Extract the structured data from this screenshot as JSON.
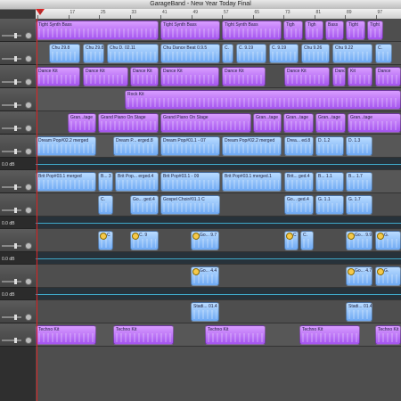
{
  "window": {
    "title": "GarageBand - New Year Today Final"
  },
  "ruler": {
    "ticks": [
      "9",
      "17",
      "25",
      "33",
      "41",
      "49",
      "57",
      "65",
      "73",
      "81",
      "89",
      "97"
    ]
  },
  "tracks": [
    {
      "type": "instrument",
      "regions": [
        {
          "name": "Tight Synth Bass",
          "color": "purple",
          "start": 0,
          "end": 138
        },
        {
          "name": "Tight Synth Bass",
          "color": "purple",
          "start": 140,
          "end": 207
        },
        {
          "name": "Tight Synth Bass",
          "color": "purple",
          "start": 209,
          "end": 276
        },
        {
          "name": "Tigh",
          "color": "purple",
          "start": 278,
          "end": 300
        },
        {
          "name": "Tigh",
          "color": "purple",
          "start": 302,
          "end": 323
        },
        {
          "name": "Bass",
          "color": "purple",
          "start": 325,
          "end": 346
        },
        {
          "name": "Tight",
          "color": "purple",
          "start": 348,
          "end": 370
        },
        {
          "name": "Tight",
          "color": "purple",
          "start": 372,
          "end": 390
        }
      ]
    },
    {
      "type": "instrument",
      "regions": [
        {
          "name": "Chu 29.8",
          "color": "blue",
          "start": 15,
          "end": 50
        },
        {
          "name": "Chu 29.8",
          "color": "blue",
          "start": 53,
          "end": 77
        },
        {
          "name": "Chu D. 02.11",
          "color": "blue",
          "start": 80,
          "end": 138
        },
        {
          "name": "Chu Dance Beat 0.9.5",
          "color": "blue",
          "start": 140,
          "end": 207
        },
        {
          "name": "C.",
          "color": "blue",
          "start": 209,
          "end": 222
        },
        {
          "name": "C. 9.19",
          "color": "blue",
          "start": 225,
          "end": 259
        },
        {
          "name": "C. 9.19",
          "color": "blue",
          "start": 262,
          "end": 295
        },
        {
          "name": "Chu 9.26",
          "color": "blue",
          "start": 298,
          "end": 330
        },
        {
          "name": "Chu 9.22",
          "color": "blue",
          "start": 333,
          "end": 378
        },
        {
          "name": "C.",
          "color": "blue",
          "start": 381,
          "end": 400
        }
      ]
    },
    {
      "type": "instrument",
      "regions": [
        {
          "name": "Dance Kit",
          "color": "purple",
          "start": 0,
          "end": 50
        },
        {
          "name": "Dance Kit",
          "color": "purple",
          "start": 53,
          "end": 104
        },
        {
          "name": "Dance Kit",
          "color": "purple",
          "start": 106,
          "end": 138
        },
        {
          "name": "Dance Kit",
          "color": "purple",
          "start": 140,
          "end": 206
        },
        {
          "name": "Dance Kit",
          "color": "purple",
          "start": 209,
          "end": 258
        },
        {
          "name": "Dance Kit",
          "color": "purple",
          "start": 279,
          "end": 330
        },
        {
          "name": "Dance",
          "color": "purple",
          "start": 333,
          "end": 348
        },
        {
          "name": "Kit",
          "color": "purple",
          "start": 350,
          "end": 378
        },
        {
          "name": "Dance",
          "color": "purple",
          "start": 381,
          "end": 410
        }
      ]
    },
    {
      "type": "instrument",
      "regions": [
        {
          "name": "Rock Kit",
          "color": "purple",
          "start": 100,
          "end": 410
        }
      ]
    },
    {
      "type": "instrument",
      "regions": [
        {
          "name": "Gran...tage",
          "color": "purple",
          "start": 36,
          "end": 68
        },
        {
          "name": "Grand Piano On Stage",
          "color": "purple",
          "start": 70,
          "end": 138
        },
        {
          "name": "Grand Piano On Stage",
          "color": "purple",
          "start": 140,
          "end": 242
        },
        {
          "name": "Gran...tage",
          "color": "purple",
          "start": 244,
          "end": 276
        },
        {
          "name": "Gran...tage",
          "color": "purple",
          "start": 278,
          "end": 312
        },
        {
          "name": "Gran...tage",
          "color": "purple",
          "start": 314,
          "end": 348
        },
        {
          "name": "Gran...tage",
          "color": "purple",
          "start": 350,
          "end": 410
        }
      ]
    },
    {
      "type": "audio",
      "regions": [
        {
          "name": "Dream Pop#02.2 merged",
          "color": "blue",
          "start": 0,
          "end": 68
        },
        {
          "name": "Dream P... erged.8",
          "color": "blue",
          "start": 87,
          "end": 138
        },
        {
          "name": "Dream Pop#01.1 - 07",
          "color": "blue",
          "start": 140,
          "end": 207
        },
        {
          "name": "Dream Pop#02.2 merged",
          "color": "blue",
          "start": 209,
          "end": 276
        },
        {
          "name": "Drea... ed.8",
          "color": "blue",
          "start": 279,
          "end": 312
        },
        {
          "name": "D. 1.2",
          "color": "blue",
          "start": 314,
          "end": 346
        },
        {
          "name": "D. 1.3",
          "color": "blue",
          "start": 348,
          "end": 378
        }
      ]
    },
    {
      "type": "volume",
      "label": "0.0 dB"
    },
    {
      "type": "audio",
      "regions": [
        {
          "name": "Brit Pop#03.1 merged",
          "color": "blue",
          "start": 0,
          "end": 68
        },
        {
          "name": "B... 3",
          "color": "blue",
          "start": 70,
          "end": 87
        },
        {
          "name": "Brit Pop... erged.4",
          "color": "blue",
          "start": 89,
          "end": 138
        },
        {
          "name": "Brit Pop#03.1 - 09",
          "color": "blue",
          "start": 140,
          "end": 207
        },
        {
          "name": "Brit Pop#03.1 merged.1",
          "color": "blue",
          "start": 209,
          "end": 276
        },
        {
          "name": "Brit... ged.4",
          "color": "blue",
          "start": 279,
          "end": 312
        },
        {
          "name": "B... 1.1",
          "color": "blue",
          "start": 314,
          "end": 346
        },
        {
          "name": "B... 1.7",
          "color": "blue",
          "start": 348,
          "end": 378
        }
      ]
    },
    {
      "type": "audio",
      "regions": [
        {
          "name": "C.",
          "color": "blue",
          "start": 70,
          "end": 87
        },
        {
          "name": "Go... ged.4",
          "color": "blue",
          "start": 106,
          "end": 138
        },
        {
          "name": "Gospel Choir#01.1 C",
          "color": "blue",
          "start": 140,
          "end": 207
        },
        {
          "name": "Go... ged.4",
          "color": "blue",
          "start": 279,
          "end": 312
        },
        {
          "name": "G. 1.1",
          "color": "blue",
          "start": 314,
          "end": 346
        },
        {
          "name": "G. 1.7",
          "color": "blue",
          "start": 348,
          "end": 378
        }
      ]
    },
    {
      "type": "volume",
      "label": "0.0 dB"
    },
    {
      "type": "audio",
      "regions": [
        {
          "name": "C",
          "color": "blue",
          "start": 70,
          "end": 87,
          "icon": true
        },
        {
          "name": "C. 9",
          "color": "blue",
          "start": 106,
          "end": 138,
          "icon": true
        },
        {
          "name": "Go... 9.7",
          "color": "blue",
          "start": 174,
          "end": 206,
          "icon": true
        },
        {
          "name": "C",
          "color": "blue",
          "start": 279,
          "end": 295,
          "icon": true
        },
        {
          "name": "C.",
          "color": "blue",
          "start": 297,
          "end": 312
        },
        {
          "name": "Go... 9.9",
          "color": "blue",
          "start": 348,
          "end": 378,
          "icon": true
        },
        {
          "name": "G.",
          "color": "blue",
          "start": 381,
          "end": 410,
          "icon": true
        }
      ]
    },
    {
      "type": "volume",
      "label": "0.0 dB"
    },
    {
      "type": "audio",
      "regions": [
        {
          "name": "Go... 4.4",
          "color": "blue",
          "start": 174,
          "end": 206,
          "icon": true
        },
        {
          "name": "Go... 4.7",
          "color": "blue",
          "start": 348,
          "end": 378,
          "icon": true
        },
        {
          "name": "G.",
          "color": "blue",
          "start": 381,
          "end": 410,
          "icon": true
        }
      ]
    },
    {
      "type": "volume",
      "label": "0.0 dB"
    },
    {
      "type": "audio",
      "regions": [
        {
          "name": "Stadi... 01.4",
          "color": "blue",
          "start": 174,
          "end": 206
        },
        {
          "name": "Stadi... 01.4",
          "color": "blue",
          "start": 348,
          "end": 378
        }
      ]
    },
    {
      "type": "instrument",
      "regions": [
        {
          "name": "Techno Kit",
          "color": "purple",
          "start": 0,
          "end": 68
        },
        {
          "name": "Techno Kit",
          "color": "purple",
          "start": 87,
          "end": 155
        },
        {
          "name": "Techno Kit",
          "color": "purple",
          "start": 190,
          "end": 258
        },
        {
          "name": "Techno Kit",
          "color": "purple",
          "start": 296,
          "end": 364
        },
        {
          "name": "Techno Kit",
          "color": "purple",
          "start": 381,
          "end": 410
        }
      ]
    }
  ]
}
